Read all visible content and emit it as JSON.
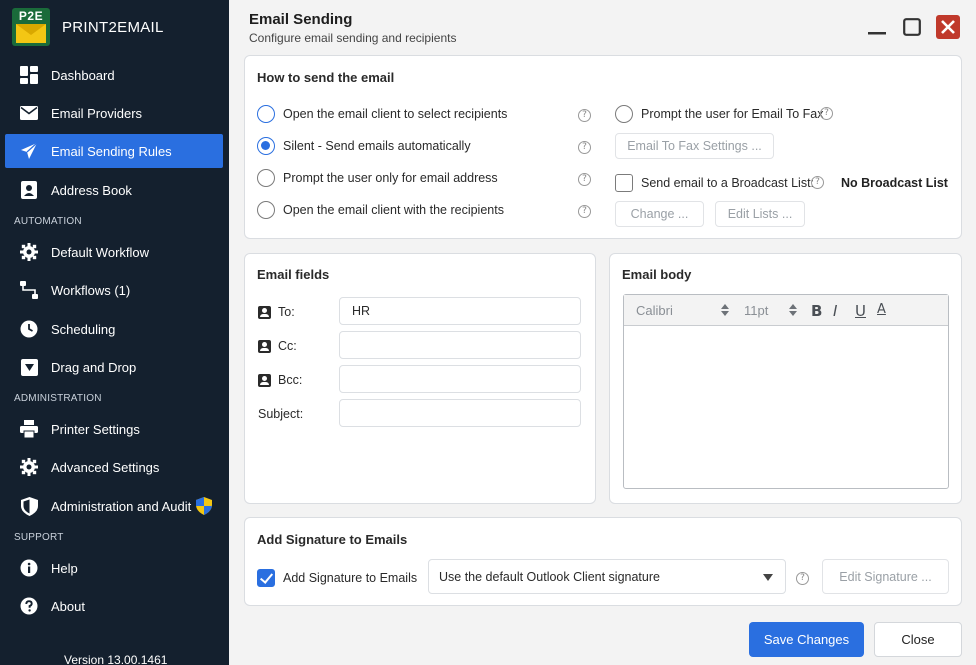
{
  "app": {
    "brand_logo_text": "P2E",
    "brand_name": "PRINT2EMAIL",
    "version": "Version 13.00.1461"
  },
  "sidebar": {
    "items": [
      {
        "label": "Dashboard",
        "icon": "dashboard-icon"
      },
      {
        "label": "Email Providers",
        "icon": "envelope-icon"
      },
      {
        "label": "Email Sending Rules",
        "icon": "paper-plane-icon",
        "active": true
      },
      {
        "label": "Address Book",
        "icon": "contact-card-icon"
      }
    ],
    "automation_label": "AUTOMATION",
    "automation_items": [
      {
        "label": "Default Workflow",
        "icon": "gear-icon"
      },
      {
        "label": "Workflows (1)",
        "icon": "workflow-icon"
      },
      {
        "label": "Scheduling",
        "icon": "clock-icon"
      },
      {
        "label": "Drag and Drop",
        "icon": "drag-drop-icon"
      }
    ],
    "administration_label": "ADMINISTRATION",
    "administration_items": [
      {
        "label": "Printer Settings",
        "icon": "printer-icon"
      },
      {
        "label": "Advanced Settings",
        "icon": "gear-icon"
      },
      {
        "label": "Administration and Audit",
        "icon": "shield-icon"
      }
    ],
    "support_label": "SUPPORT",
    "support_items": [
      {
        "label": "Help",
        "icon": "info-icon"
      },
      {
        "label": "About",
        "icon": "question-icon"
      }
    ]
  },
  "header": {
    "title": "Email Sending",
    "subtitle": "Configure email sending and recipients"
  },
  "how_to_send": {
    "title": "How to send the email",
    "options": [
      {
        "label": "Open the email client to select recipients",
        "selected": false
      },
      {
        "label": "Silent - Send emails automatically",
        "selected": true
      },
      {
        "label": "Prompt the user only for email address",
        "selected": false
      },
      {
        "label": "Open the email client with the recipients",
        "selected": false
      }
    ],
    "help_glyph": "?",
    "fax_prompt_label": "Prompt the user for Email To Fax",
    "fax_settings_button": "Email To Fax Settings ...",
    "broadcast_label": "Send email to a Broadcast List:",
    "broadcast_value": "No Broadcast List",
    "change_button": "Change ...",
    "edit_lists_button": "Edit Lists ..."
  },
  "email_fields": {
    "title": "Email fields",
    "to_label": "To:",
    "to_value": "HR",
    "cc_label": "Cc:",
    "cc_value": "",
    "bcc_label": "Bcc:",
    "bcc_value": "",
    "subject_label": "Subject:",
    "subject_value": ""
  },
  "email_body": {
    "title": "Email body",
    "font": "Calibri",
    "size": "11pt",
    "bold": "B",
    "italic": "I",
    "underline": "U",
    "color": "A"
  },
  "signature": {
    "title": "Add Signature to Emails",
    "checkbox_label": "Add Signature to Emails",
    "checked": true,
    "dropdown_value": "Use the default Outlook Client signature",
    "edit_button": "Edit Signature ..."
  },
  "footer": {
    "save_label": "Save Changes",
    "close_label": "Close"
  },
  "colors": {
    "accent": "#2a6fe0",
    "sidebar_bg": "#14202e",
    "close_red": "#c0392b"
  }
}
